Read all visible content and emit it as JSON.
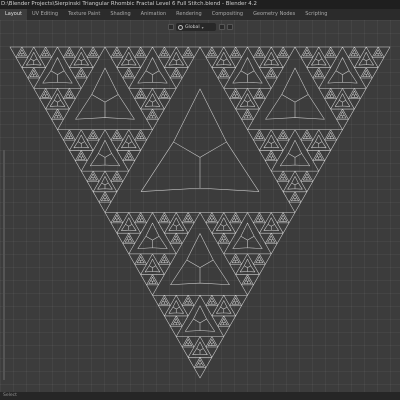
{
  "window": {
    "title": "D:\\Blender Projects\\Sierpinski Triangular Rhombic Fractal Level 6 Full Stitch.blend - Blender 4.2"
  },
  "workspaces": [
    {
      "label": "Layout",
      "active": true
    },
    {
      "label": "UV Editing",
      "active": false
    },
    {
      "label": "Texture Paint",
      "active": false
    },
    {
      "label": "Shading",
      "active": false
    },
    {
      "label": "Animation",
      "active": false
    },
    {
      "label": "Rendering",
      "active": false
    },
    {
      "label": "Compositing",
      "active": false
    },
    {
      "label": "Geometry Nodes",
      "active": false
    },
    {
      "label": "Scripting",
      "active": false
    }
  ],
  "viewport": {
    "transform_orientation": "Global",
    "line_color": "#cfcfcf",
    "background_color": "#3c3c3c",
    "fractal_level": 6
  },
  "statusbar": {
    "text": "Select"
  }
}
